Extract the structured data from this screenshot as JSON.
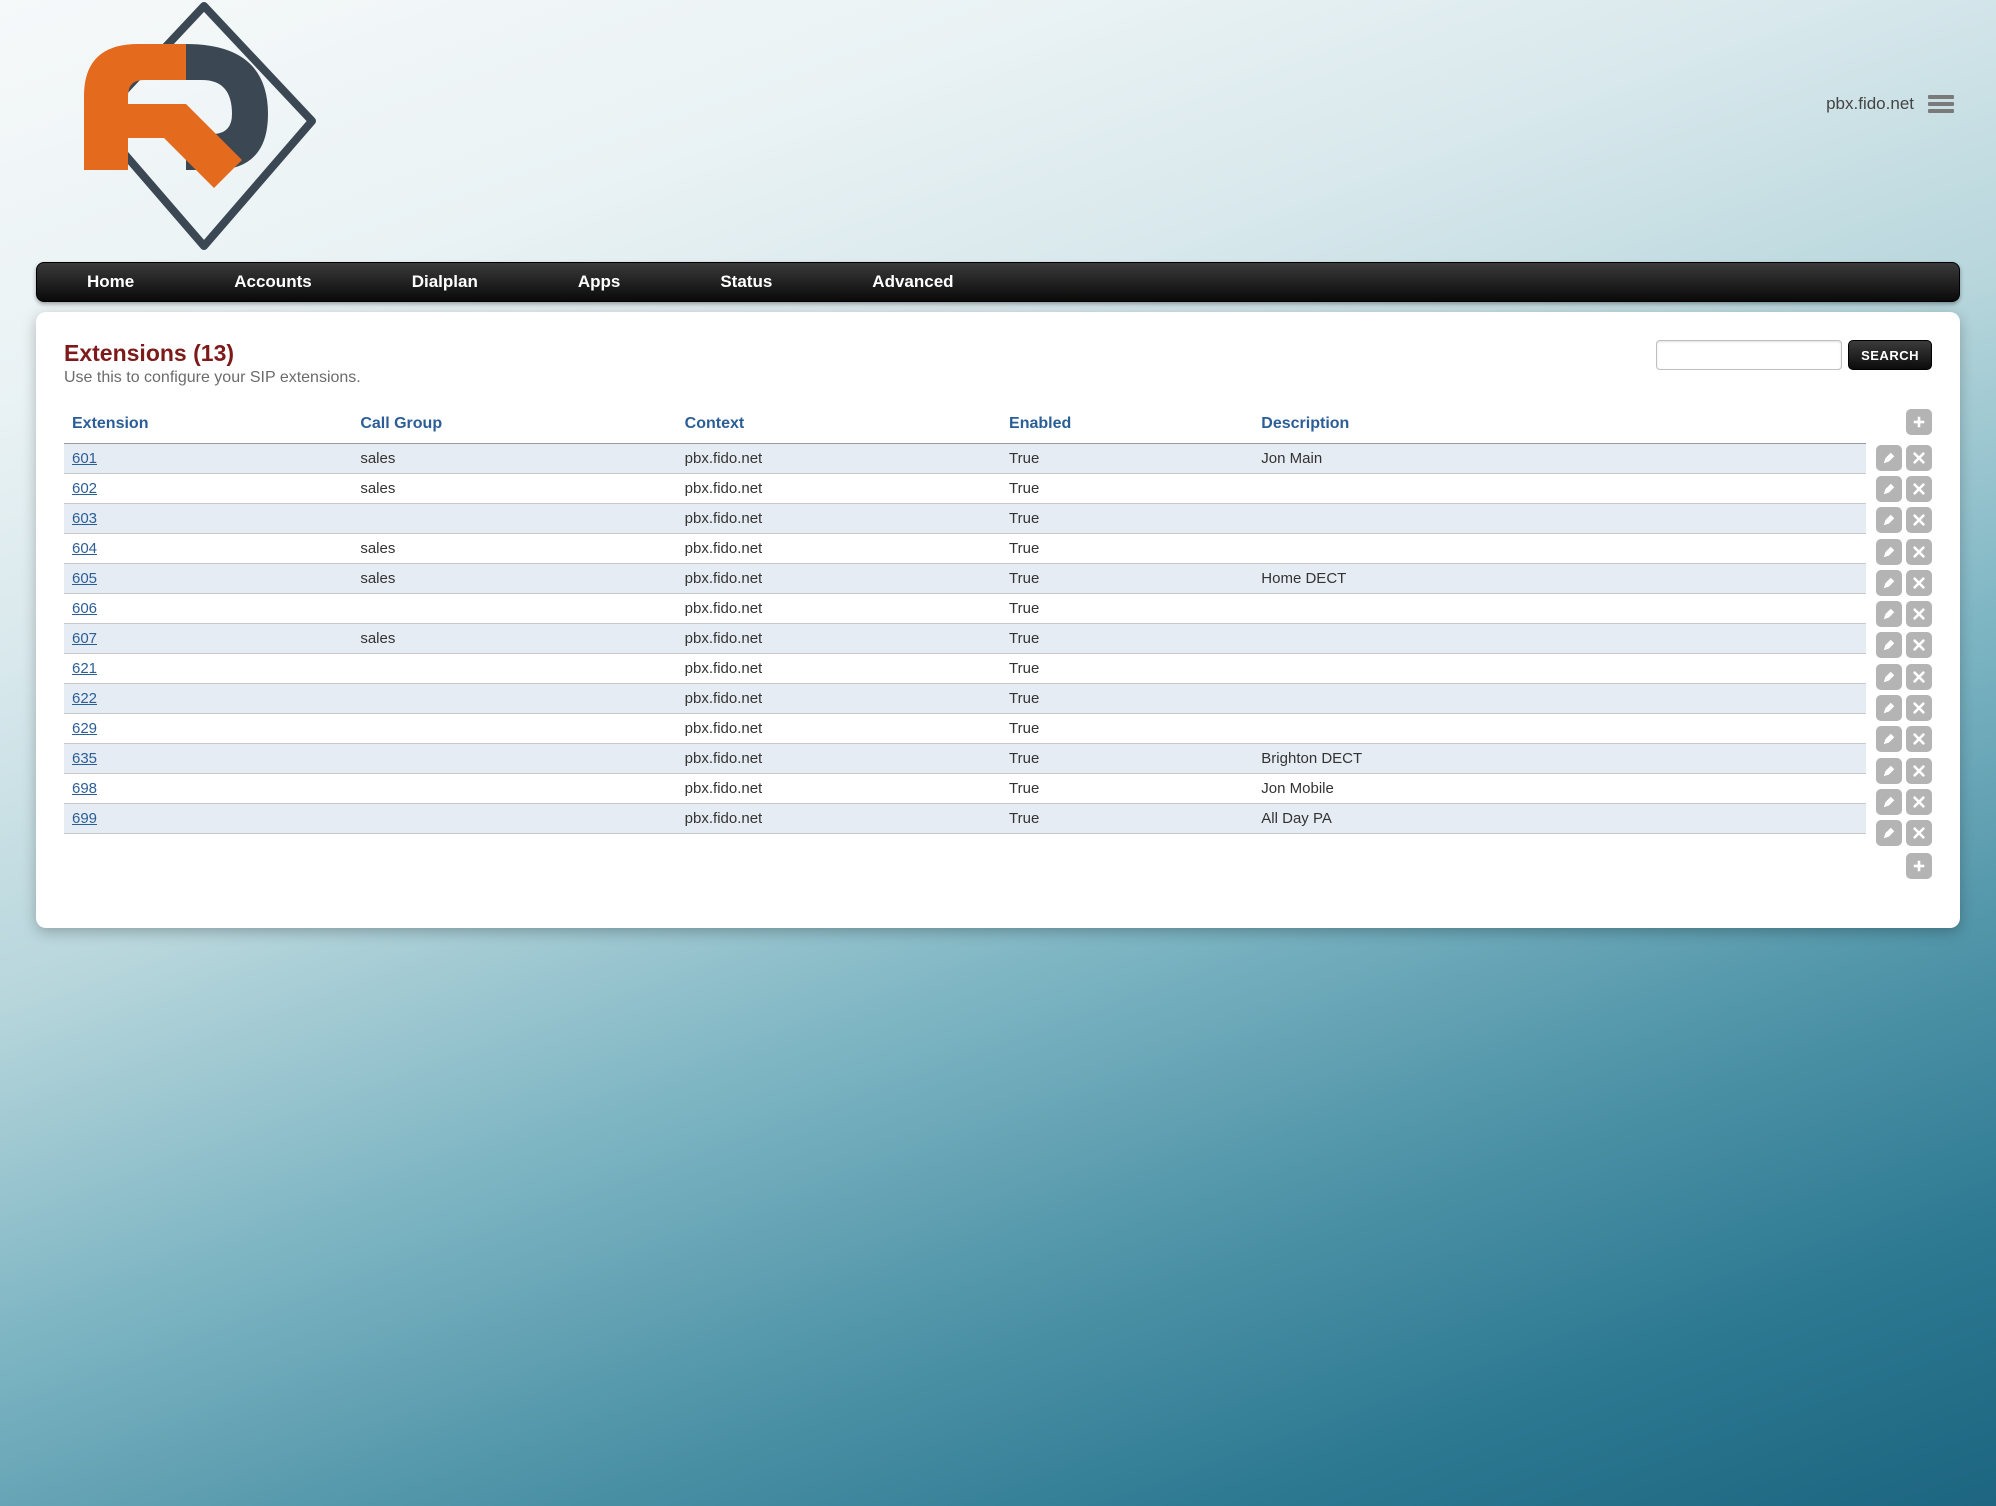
{
  "header": {
    "domain_label": "pbx.fido.net"
  },
  "nav": {
    "items": [
      "Home",
      "Accounts",
      "Dialplan",
      "Apps",
      "Status",
      "Advanced"
    ]
  },
  "page": {
    "title_prefix": "Extensions",
    "count": 13,
    "subtitle": "Use this to configure your SIP extensions.",
    "search_button": "SEARCH",
    "search_value": ""
  },
  "columns": [
    "Extension",
    "Call Group",
    "Context",
    "Enabled",
    "Description"
  ],
  "rows": [
    {
      "ext": "601",
      "call_group": "sales",
      "context": "pbx.fido.net",
      "enabled": "True",
      "description": "Jon Main"
    },
    {
      "ext": "602",
      "call_group": "sales",
      "context": "pbx.fido.net",
      "enabled": "True",
      "description": ""
    },
    {
      "ext": "603",
      "call_group": "",
      "context": "pbx.fido.net",
      "enabled": "True",
      "description": ""
    },
    {
      "ext": "604",
      "call_group": "sales",
      "context": "pbx.fido.net",
      "enabled": "True",
      "description": ""
    },
    {
      "ext": "605",
      "call_group": "sales",
      "context": "pbx.fido.net",
      "enabled": "True",
      "description": "Home DECT"
    },
    {
      "ext": "606",
      "call_group": "",
      "context": "pbx.fido.net",
      "enabled": "True",
      "description": ""
    },
    {
      "ext": "607",
      "call_group": "sales",
      "context": "pbx.fido.net",
      "enabled": "True",
      "description": ""
    },
    {
      "ext": "621",
      "call_group": "",
      "context": "pbx.fido.net",
      "enabled": "True",
      "description": ""
    },
    {
      "ext": "622",
      "call_group": "",
      "context": "pbx.fido.net",
      "enabled": "True",
      "description": ""
    },
    {
      "ext": "629",
      "call_group": "",
      "context": "pbx.fido.net",
      "enabled": "True",
      "description": ""
    },
    {
      "ext": "635",
      "call_group": "",
      "context": "pbx.fido.net",
      "enabled": "True",
      "description": "Brighton DECT"
    },
    {
      "ext": "698",
      "call_group": "",
      "context": "pbx.fido.net",
      "enabled": "True",
      "description": "Jon Mobile"
    },
    {
      "ext": "699",
      "call_group": "",
      "context": "pbx.fido.net",
      "enabled": "True",
      "description": "All Day PA"
    }
  ]
}
